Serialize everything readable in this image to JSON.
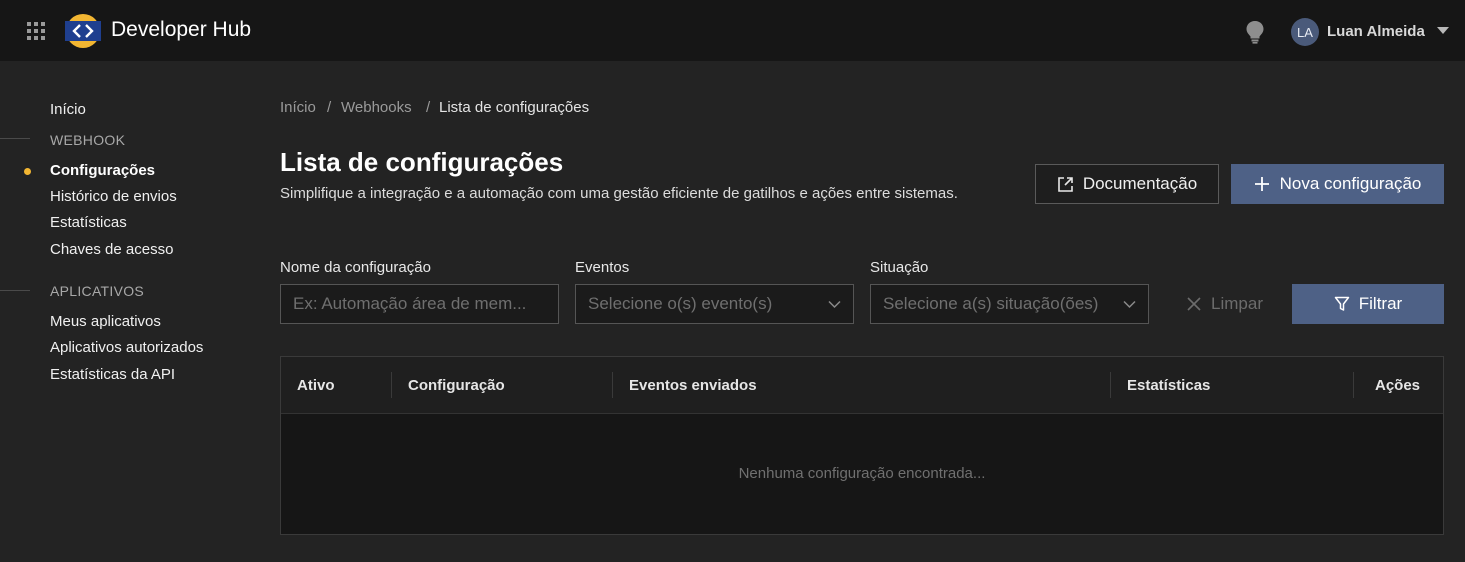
{
  "header": {
    "app_title": "Developer Hub",
    "user_initials": "LA",
    "user_name": "Luan Almeida",
    "icons": [
      "apps-grid-icon",
      "developer-hub-logo",
      "lightbulb-icon",
      "caret-down-icon"
    ]
  },
  "sidebar": {
    "home": "Início",
    "webhook_section": "WEBHOOK",
    "webhook_items": [
      "Configurações",
      "Histórico de envios",
      "Estatísticas",
      "Chaves de acesso"
    ],
    "active_item": "Configurações",
    "apps_section": "APLICATIVOS",
    "apps_items": [
      "Meus aplicativos",
      "Aplicativos autorizados",
      "Estatísticas da API"
    ]
  },
  "breadcrumb": {
    "items": [
      "Início",
      "Webhooks",
      "Lista de configurações"
    ],
    "separator": "/"
  },
  "page": {
    "title": "Lista de configurações",
    "description": "Simplifique a integração e a automação com uma gestão eficiente de gatilhos e ações entre sistemas.",
    "doc_button": "Documentação",
    "new_button": "Nova configuração"
  },
  "filters": {
    "name_label": "Nome da configuração",
    "name_placeholder": "Ex: Automação área de mem...",
    "events_label": "Eventos",
    "events_placeholder": "Selecione o(s) evento(s)",
    "status_label": "Situação",
    "status_placeholder": "Selecione a(s) situação(ões)",
    "clear_button": "Limpar",
    "filter_button": "Filtrar"
  },
  "table": {
    "columns": [
      "Ativo",
      "Configuração",
      "Eventos enviados",
      "Estatísticas",
      "Ações"
    ],
    "empty_message": "Nenhuma configuração encontrada..."
  },
  "colors": {
    "accent_button": "#4e6186",
    "active_dot": "#f2b632",
    "logo_ring": "#f2b632",
    "logo_center": "#1f3f8f",
    "background": "#232323",
    "topbar": "#161616"
  }
}
